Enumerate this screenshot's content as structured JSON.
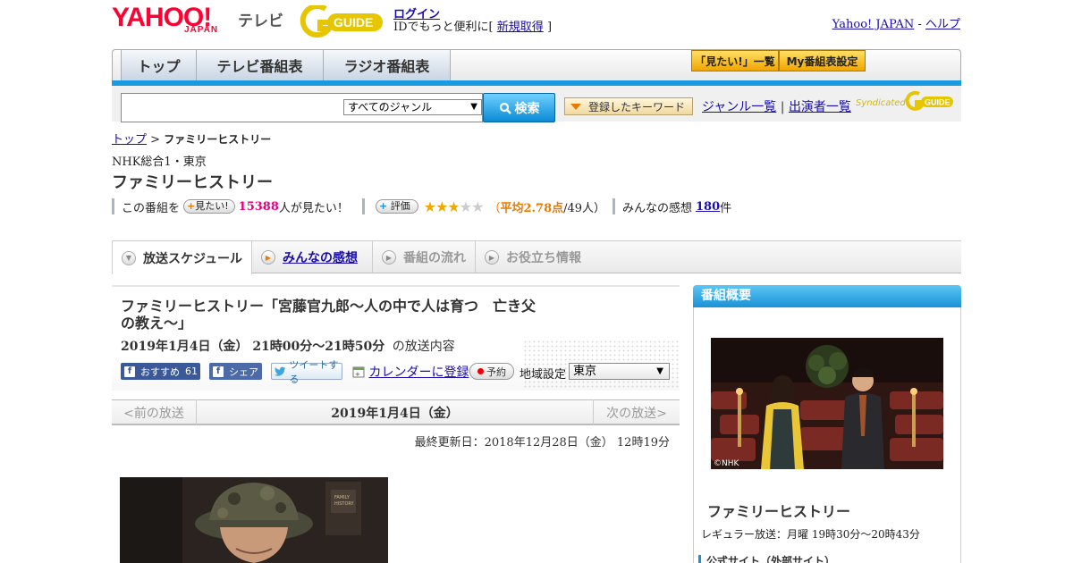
{
  "header": {
    "yahoo_logo": "YAHOO!",
    "japan_logo": "JAPAN",
    "tv_label": "テレビ",
    "login": "ログイン",
    "login_sub": "IDでもっと便利に[",
    "register": "新規取得",
    "login_sub_end": "]",
    "yahoo_japan": "Yahoo! JAPAN",
    "link_sep": "-",
    "help": "ヘルプ"
  },
  "nav": {
    "top": "トップ",
    "tv_guide": "テレビ番組表",
    "radio_guide": "ラジオ番組表",
    "mitai_list": "「見たい!」一覧",
    "my_guide": "My番組表設定"
  },
  "search": {
    "genre_selected": "すべてのジャンル",
    "search_button": "検索",
    "keyword_button": "登録したキーワード",
    "genre_list": "ジャンル一覧",
    "separator": "|",
    "performer_list": "出演者一覧",
    "syndicated": "Syndicated"
  },
  "breadcrumb": {
    "top": "トップ",
    "sep": ">",
    "current": "ファミリーヒストリー"
  },
  "program": {
    "channel": "NHK総合1・東京",
    "title": "ファミリーヒストリー",
    "this_program": "この番組を",
    "mitai_badge": "見たい!",
    "mitai_count": "15388",
    "mitai_suffix": "人が見たい！",
    "rating_badge": "評価",
    "rating_open": "（",
    "rating_avg": "平均2.78点",
    "rating_count": "/49人）",
    "reviews_label": "みんなの感想",
    "reviews_count": "180",
    "reviews_suffix": "件"
  },
  "rating_value": 2.78,
  "tabs": {
    "schedule": "放送スケジュール",
    "reviews": "みんなの感想",
    "flow": "番組の流れ",
    "info": "お役立ち情報"
  },
  "episode": {
    "title": "ファミリーヒストリー「宮藤官九郎～人の中で人は育つ　亡き父の教え～」",
    "date_time": "2019年1月4日（金）  21時00分～21時50分",
    "date_suffix": "の放送内容",
    "fb_recommend": "おすすめ",
    "fb_count": "61",
    "fb_share": "シェア",
    "tweet": "ツイートする",
    "calendar": "カレンダーに登録",
    "reserve": "予約",
    "region_label": "地域設定",
    "region_value": "東京"
  },
  "pager": {
    "prev": "<前の放送",
    "date": "2019年1月4日（金）",
    "next": "次の放送>",
    "updated": "最終更新日：2018年12月28日（金）  12時19分"
  },
  "sidebar": {
    "heading": "番組概要",
    "image_credit": "©NHK",
    "title": "ファミリーヒストリー",
    "regular": "レギュラー放送：月曜 19時30分～20時43分",
    "official_site": "公式サイト（外部サイト）"
  },
  "colors": {
    "accent_blue": "#1a9be0",
    "yahoo_red": "#ff0033",
    "mitai_pink": "#e4007f",
    "rating_orange": "#e87a00"
  }
}
